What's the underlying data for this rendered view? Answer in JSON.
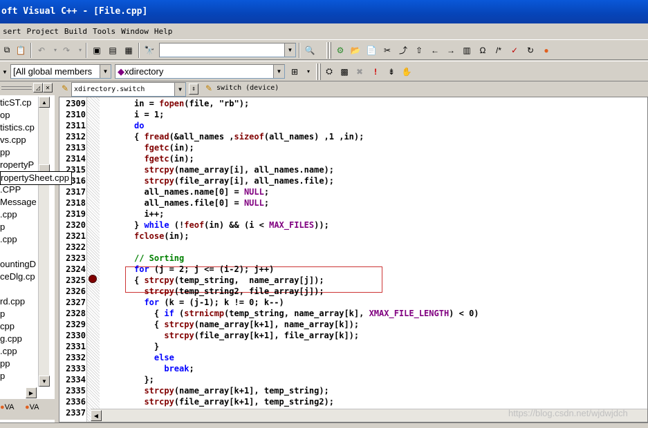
{
  "window": {
    "title": "oft Visual C++ - [File.cpp]"
  },
  "menu": [
    "sert",
    "Project",
    "Build",
    "Tools",
    "Window",
    "Help"
  ],
  "toolbar": {
    "find_value": "",
    "class_combo": "[All global members",
    "member_combo": "xdirectory"
  },
  "workspace": {
    "files": [
      "ticST.cp",
      "op",
      "tistics.cp",
      "vs.cpp",
      "pp",
      "ropertyP",
      "ropertySheet.cpp",
      ".CPP",
      "Message",
      ".cpp",
      "p",
      ".cpp",
      "",
      "ountingD",
      "ceDlg.cp",
      "",
      "rd.cpp",
      "p",
      "cpp",
      "g.cpp",
      ".cpp",
      "pp",
      "p"
    ],
    "tooltip": "ropertySheet.cpp",
    "tabs": [
      "VA",
      "VA"
    ]
  },
  "editor": {
    "scope_combo": "xdirectory.switch",
    "context_label": "switch (device)",
    "line_numbers": [
      "2309",
      "2310",
      "2311",
      "2312",
      "2313",
      "2314",
      "2315",
      "2316",
      "2317",
      "2318",
      "2319",
      "2320",
      "2321",
      "2322",
      "2323",
      "2324",
      "2325",
      "2326",
      "2327",
      "2328",
      "2329",
      "2330",
      "2331",
      "2332",
      "2333",
      "2334",
      "2335",
      "2336",
      "2337"
    ],
    "lines": [
      "in = fopen(file, \"rb\");",
      "i = 1;",
      "do",
      "{ fread(&all_names ,sizeof(all_names) ,1 ,in);",
      "  fgetc(in);",
      "  fgetc(in);",
      "  strcpy(name_array[i], all_names.name);",
      "  strcpy(file_array[i], all_names.file);",
      "  all_names.name[0] = NULL;",
      "  all_names.file[0] = NULL;",
      "  i++;",
      "} while (!feof(in) && (i < MAX_FILES));",
      "fclose(in);",
      "",
      "// Sorting",
      "for (j = 2; j <= (i-2); j++)",
      "{ strcpy(temp_string,  name_array[j]);",
      "  strcpy(temp_string2, file_array[j]);",
      "  for (k = (j-1); k != 0; k--)",
      "    { if (strnicmp(temp_string, name_array[k], XMAX_FILE_LENGTH) < 0)",
      "    { strcpy(name_array[k+1], name_array[k]);",
      "      strcpy(file_array[k+1], file_array[k]);",
      "    }",
      "    else",
      "      break;",
      "  };",
      "  strcpy(name_array[k+1], temp_string);",
      "  strcpy(file_array[k+1], temp_string2);",
      ""
    ],
    "breakpoint_line": "2325",
    "colors": {
      "keyword": "#0000ff",
      "function": "#800000",
      "macro": "#800080",
      "comment": "#008000"
    }
  },
  "watermark": "https://blog.csdn.net/wjdwjdch"
}
